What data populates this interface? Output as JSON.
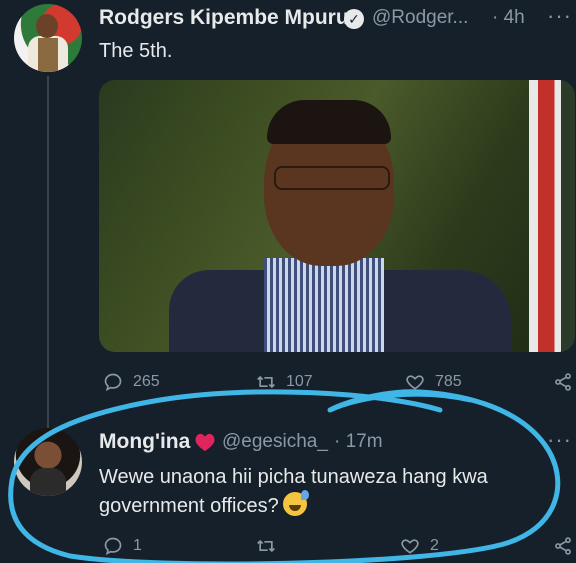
{
  "tweet1": {
    "display_name": "Rodgers Kipembe Mpuru",
    "handle": "@Rodger...",
    "time": "· 4h",
    "more": "···",
    "text": "The 5th.",
    "actions": {
      "replies": "265",
      "retweets": "107",
      "likes": "785"
    }
  },
  "tweet2": {
    "display_name": "Mong'ina",
    "handle": "@egesicha_",
    "time": "· 17m",
    "more": "···",
    "text_line1": "Wewe unaona hii picha tunaweza hang kwa",
    "text_line2": "government offices?",
    "actions": {
      "replies": "1",
      "retweets": "",
      "likes": "2"
    }
  },
  "colors": {
    "background": "#15202b",
    "text": "#e7e9ea",
    "muted": "#8b98a5",
    "heart": "#e0245e",
    "annotation": "#3fb6e6"
  }
}
